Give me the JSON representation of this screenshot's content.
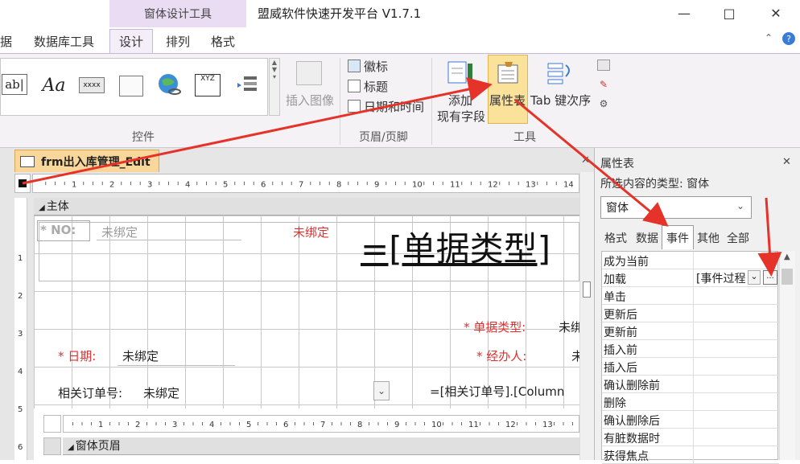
{
  "titlebar": {
    "context_tab": "窗体设计工具",
    "app_title": "盟威软件快速开发平台 V1.7.1",
    "minimize": "—",
    "maximize": "□",
    "close": "✕"
  },
  "tabs": {
    "partial": "据",
    "db_tools": "数据库工具",
    "design": "设计",
    "arrange": "排列",
    "format": "格式"
  },
  "ribbon": {
    "controls_group": "控件",
    "insert_image": "插入图像",
    "logo": "徽标",
    "title": "标题",
    "date_time": "日期和时间",
    "header_footer_group": "页眉/页脚",
    "add_field_1": "添加",
    "add_field_2": "现有字段",
    "property_sheet": "属性表",
    "tab_order": "Tab 键次序",
    "tools_group": "工具",
    "xyz": "XYZ",
    "xxxx": "xxxx",
    "ab": "ab|",
    "aa": "Aa"
  },
  "document": {
    "tab_title": "frm出入库管理_Edit",
    "section_main": "主体",
    "section_sub": "窗体页眉",
    "ruler_marks": [
      "1",
      "2",
      "3",
      "4",
      "5",
      "6",
      "7",
      "8",
      "9",
      "10",
      "11",
      "12",
      "13",
      "14"
    ],
    "vruler_marks": [
      "1",
      "2",
      "3",
      "4",
      "5",
      "6"
    ],
    "fields": {
      "no_label": "* NO:",
      "no_value": "未绑定",
      "unbound_red": "未绑定",
      "big_title": "=[单据类型]",
      "doc_type_label": "* 单据类型:",
      "doc_type_value": "未绑",
      "date_label": "* 日期:",
      "date_value": "未绑定",
      "handler_label": "* 经办人:",
      "handler_value": "未",
      "order_label": "相关订单号:",
      "order_value": "未绑定",
      "order_expr": "=[相关订单号].[Column"
    }
  },
  "property_sheet": {
    "title": "属性表",
    "close": "✕",
    "selection_type": "所选内容的类型: 窗体",
    "selected_object": "窗体",
    "tabs": [
      "格式",
      "数据",
      "事件",
      "其他",
      "全部"
    ],
    "active_tab": "事件",
    "rows": [
      {
        "name": "成为当前",
        "value": ""
      },
      {
        "name": "加载",
        "value": "[事件过程"
      },
      {
        "name": "单击",
        "value": ""
      },
      {
        "name": "更新后",
        "value": ""
      },
      {
        "name": "更新前",
        "value": ""
      },
      {
        "name": "插入前",
        "value": ""
      },
      {
        "name": "插入后",
        "value": ""
      },
      {
        "name": "确认删除前",
        "value": ""
      },
      {
        "name": "删除",
        "value": ""
      },
      {
        "name": "确认删除后",
        "value": ""
      },
      {
        "name": "有脏数据时",
        "value": ""
      },
      {
        "name": "获得焦点",
        "value": ""
      }
    ],
    "build_button": "..."
  },
  "colors": {
    "accent_purple": "#e9dcf3",
    "highlight": "#fbe29a",
    "arrow": "#e5332a",
    "red_text": "#e03030"
  }
}
